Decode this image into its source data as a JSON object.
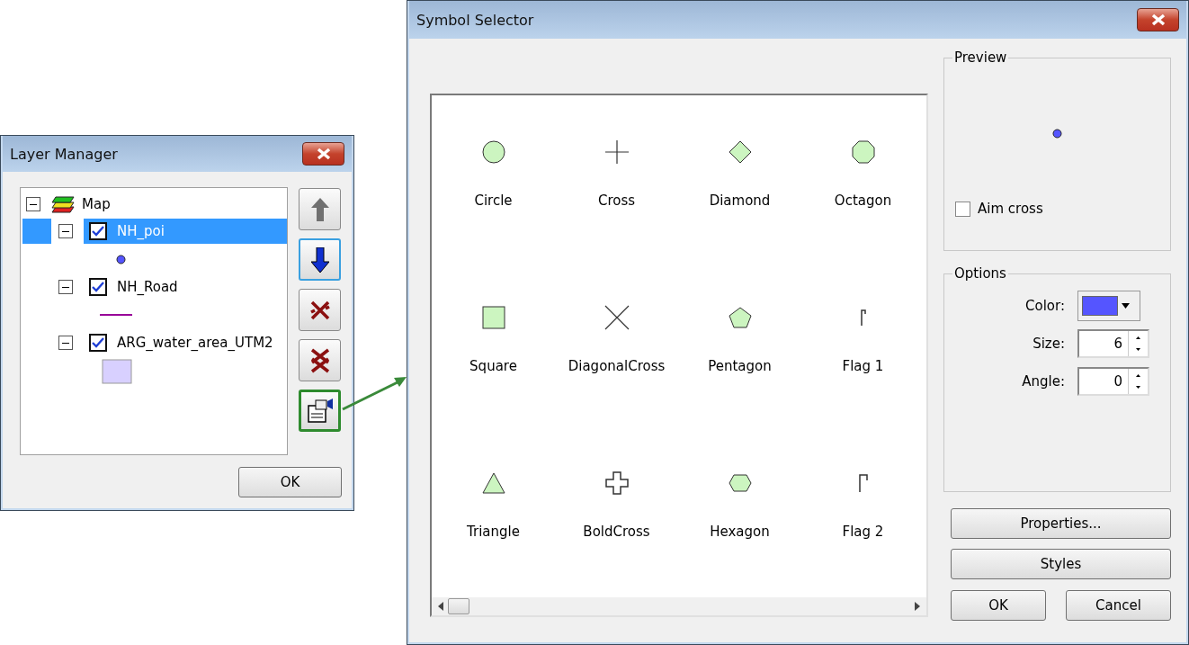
{
  "layer_manager": {
    "title": "Layer Manager",
    "tree": {
      "label": "Map",
      "expanded": true,
      "children": [
        {
          "label": "NH_poi",
          "checked": true,
          "selected": true,
          "expanded": true,
          "kind": "point",
          "color": "#5555ff"
        },
        {
          "label": "NH_Road",
          "checked": true,
          "selected": false,
          "expanded": true,
          "kind": "line",
          "color": "#990099"
        },
        {
          "label": "ARG_water_area_UTM2",
          "checked": true,
          "selected": false,
          "expanded": true,
          "kind": "polygon",
          "color": "#d8d0ff"
        }
      ]
    },
    "side_buttons": [
      {
        "kind": "up",
        "focused": false,
        "highlighted": false
      },
      {
        "kind": "down",
        "focused": true,
        "highlighted": false
      },
      {
        "kind": "remove",
        "focused": false,
        "highlighted": false
      },
      {
        "kind": "remove_all",
        "focused": false,
        "highlighted": false
      },
      {
        "kind": "properties",
        "focused": false,
        "highlighted": true
      }
    ],
    "ok_button": "OK"
  },
  "symbol_selector": {
    "title": "Symbol Selector",
    "symbols": [
      {
        "name": "Circle",
        "kind": "circle"
      },
      {
        "name": "Cross",
        "kind": "cross"
      },
      {
        "name": "Diamond",
        "kind": "diamond"
      },
      {
        "name": "Octagon",
        "kind": "octagon"
      },
      {
        "name": "Square",
        "kind": "square"
      },
      {
        "name": "DiagonalCross",
        "kind": "diagonal_cross"
      },
      {
        "name": "Pentagon",
        "kind": "pentagon"
      },
      {
        "name": "Flag 1",
        "kind": "flag1"
      },
      {
        "name": "Triangle",
        "kind": "triangle"
      },
      {
        "name": "BoldCross",
        "kind": "bold_cross"
      },
      {
        "name": "Hexagon",
        "kind": "hexagon"
      },
      {
        "name": "Flag 2",
        "kind": "flag2"
      }
    ],
    "preview": {
      "title": "Preview",
      "color": "#5555ff",
      "aim_cross": {
        "label": "Aim cross",
        "checked": false
      }
    },
    "options": {
      "title": "Options",
      "color": {
        "label": "Color:",
        "color": "#5555ff"
      },
      "size": {
        "label": "Size:",
        "value": "6"
      },
      "angle": {
        "label": "Angle:",
        "value": "0"
      }
    },
    "buttons": [
      "Properties...",
      "Styles"
    ],
    "ok": "OK",
    "cancel": "Cancel"
  }
}
